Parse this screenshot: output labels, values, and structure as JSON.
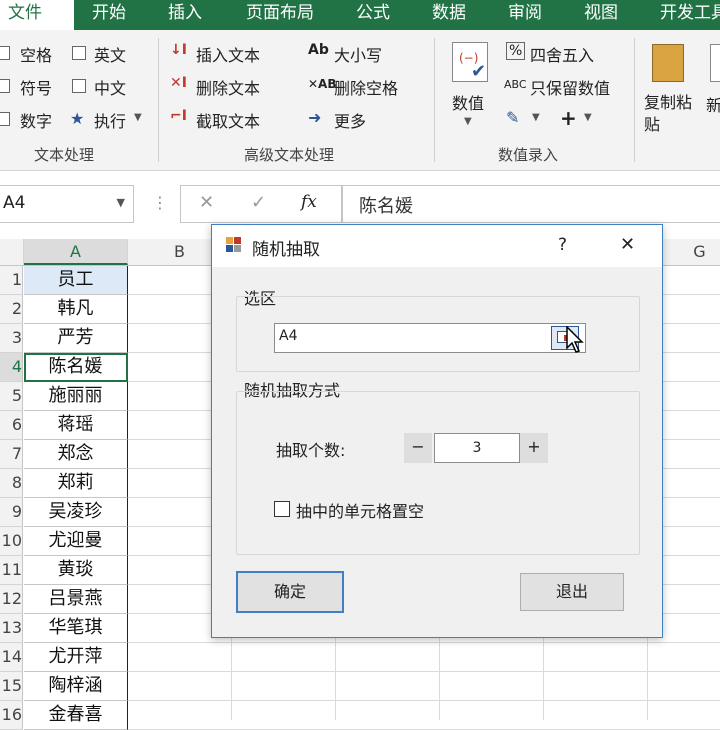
{
  "ribbon": {
    "tabs": [
      "文件",
      "开始",
      "插入",
      "页面布局",
      "公式",
      "数据",
      "审阅",
      "视图",
      "开发工具"
    ],
    "text_group": {
      "items": [
        "空格",
        "英文",
        "符号",
        "中文",
        "数字",
        "执行"
      ],
      "label": "文本处理"
    },
    "advanced_group": {
      "items": [
        "插入文本",
        "删除文本",
        "截取文本",
        "大小写",
        "删除空格",
        "更多"
      ],
      "label": "高级文本处理"
    },
    "number_group": {
      "value_btn": "数值",
      "round_btn": "四舍五入",
      "keep_btn": "只保留数值",
      "label": "数值录入"
    },
    "paste_group": {
      "label": "复制粘贴",
      "label2": "新"
    }
  },
  "formula_bar": {
    "name_box": "A4",
    "fx": "fx",
    "content": "陈名媛"
  },
  "sheet": {
    "columns": [
      "A",
      "B",
      "G"
    ],
    "rows": [
      {
        "num": "1",
        "value": "员工"
      },
      {
        "num": "2",
        "value": "韩凡"
      },
      {
        "num": "3",
        "value": "严芳"
      },
      {
        "num": "4",
        "value": "陈名媛"
      },
      {
        "num": "5",
        "value": "施丽丽"
      },
      {
        "num": "6",
        "value": "蒋瑶"
      },
      {
        "num": "7",
        "value": "郑念"
      },
      {
        "num": "8",
        "value": "郑莉"
      },
      {
        "num": "9",
        "value": "吴凌珍"
      },
      {
        "num": "10",
        "value": "尤迎曼"
      },
      {
        "num": "11",
        "value": "黄琰"
      },
      {
        "num": "12",
        "value": "吕景燕"
      },
      {
        "num": "13",
        "value": "华笔琪"
      },
      {
        "num": "14",
        "value": "尤开萍"
      },
      {
        "num": "15",
        "value": "陶梓涵"
      },
      {
        "num": "16",
        "value": "金春喜"
      }
    ]
  },
  "dialog": {
    "title": "随机抽取",
    "help": "?",
    "close": "✕",
    "selection_label": "选区",
    "selection_value": "A4",
    "method_label": "随机抽取方式",
    "count_label": "抽取个数:",
    "count_value": "3",
    "minus": "−",
    "plus": "+",
    "clear_label": "抽中的单元格置空",
    "ok": "确定",
    "exit": "退出"
  }
}
